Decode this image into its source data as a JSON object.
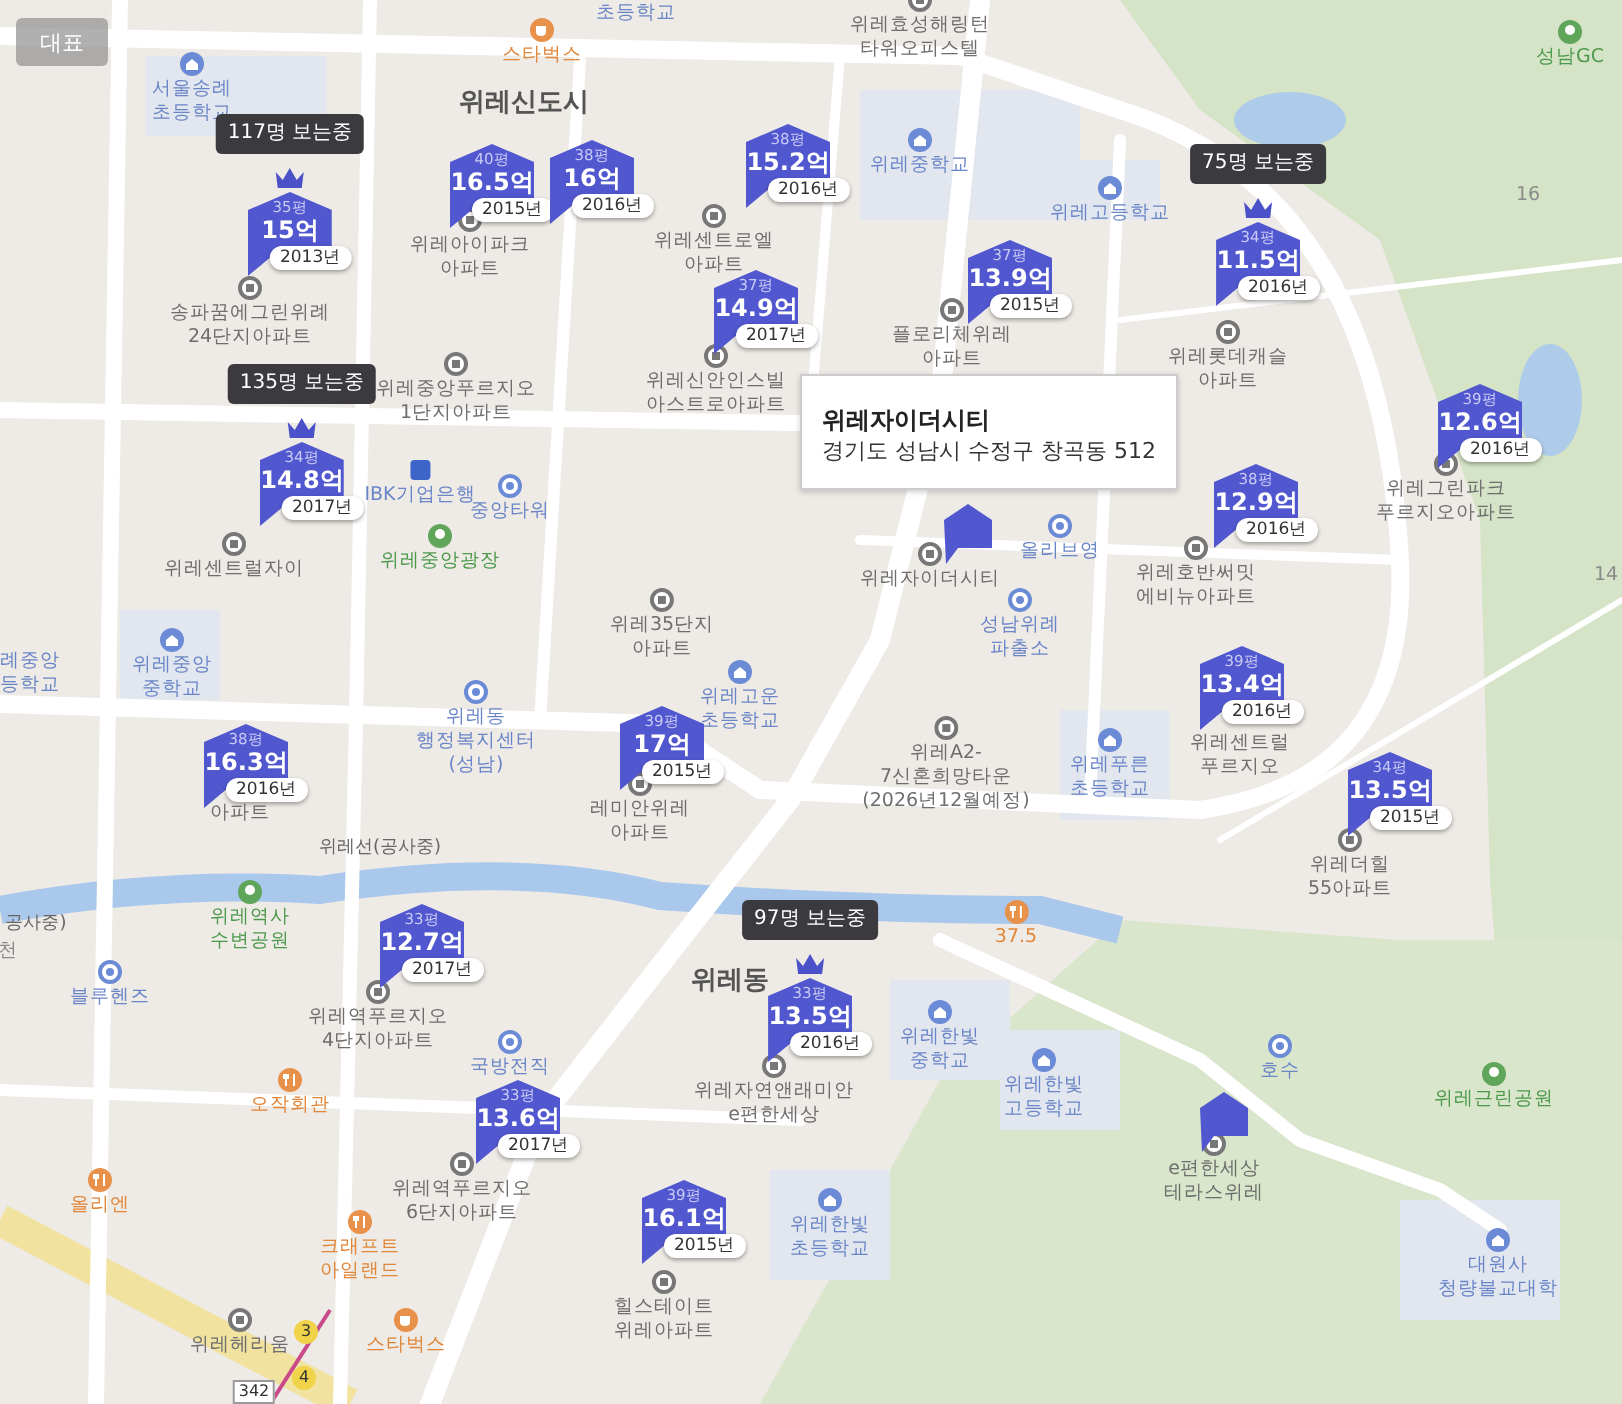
{
  "map_type_button": "대표",
  "markers": [
    {
      "kind": "price",
      "area": "35평",
      "price": "15억",
      "year": "2013년",
      "viewers": "117명 보는중"
    },
    {
      "kind": "price",
      "area": "40평",
      "price": "16.5억",
      "year": "2015년"
    },
    {
      "kind": "price",
      "area": "38평",
      "price": "16억",
      "year": "2016년"
    },
    {
      "kind": "price",
      "area": "38평",
      "price": "15.2억",
      "year": "2016년"
    },
    {
      "kind": "price",
      "area": "37평",
      "price": "14.9억",
      "year": "2017년"
    },
    {
      "kind": "price",
      "area": "37평",
      "price": "13.9억",
      "year": "2015년"
    },
    {
      "kind": "price",
      "area": "34평",
      "price": "11.5억",
      "year": "2016년",
      "viewers": "75명 보는중"
    },
    {
      "kind": "price",
      "area": "34평",
      "price": "14.8억",
      "year": "2017년",
      "viewers": "135명 보는중"
    },
    {
      "kind": "price",
      "area": "39평",
      "price": "12.6억",
      "year": "2016년"
    },
    {
      "kind": "price",
      "area": "38평",
      "price": "12.9억",
      "year": "2016년"
    },
    {
      "kind": "price",
      "area": "39평",
      "price": "13.4억",
      "year": "2016년"
    },
    {
      "kind": "price",
      "area": "38평",
      "price": "16.3억",
      "year": "2016년"
    },
    {
      "kind": "price",
      "area": "39평",
      "price": "17억",
      "year": "2015년"
    },
    {
      "kind": "price",
      "area": "34평",
      "price": "13.5억",
      "year": "2015년"
    },
    {
      "kind": "price",
      "area": "33평",
      "price": "12.7억",
      "year": "2017년"
    },
    {
      "kind": "price",
      "area": "33평",
      "price": "13.5억",
      "year": "2016년",
      "viewers": "97명 보는중"
    },
    {
      "kind": "price",
      "area": "33평",
      "price": "13.6억",
      "year": "2017년"
    },
    {
      "kind": "price",
      "area": "39평",
      "price": "16.1억",
      "year": "2015년"
    },
    {
      "kind": "plain"
    },
    {
      "kind": "plain"
    }
  ],
  "places": [
    {
      "kind": "school",
      "lines": [
        "서울송례",
        "초등학교"
      ]
    },
    {
      "kind": "cafe",
      "lines": [
        "스타벅스"
      ]
    },
    {
      "kind": "school_text",
      "lines": [
        "초등학교"
      ]
    },
    {
      "kind": "apt",
      "lines": [
        "위레효성해링턴",
        "타워오피스텔"
      ]
    },
    {
      "kind": "area",
      "lines": [
        "위레신도시"
      ]
    },
    {
      "kind": "school",
      "lines": [
        "위레중학교"
      ]
    },
    {
      "kind": "school",
      "lines": [
        "위레고등학교"
      ]
    },
    {
      "kind": "park",
      "lines": [
        "성남GC"
      ]
    },
    {
      "kind": "text",
      "lines": [
        "16"
      ]
    },
    {
      "kind": "text",
      "lines": [
        "14"
      ]
    },
    {
      "kind": "apt",
      "lines": [
        "송파꿈에그린위례",
        "24단지아파트"
      ]
    },
    {
      "kind": "apt",
      "lines": [
        "위레아이파크",
        "아파트"
      ]
    },
    {
      "kind": "apt",
      "lines": [
        "위레센트로엘",
        "아파트"
      ]
    },
    {
      "kind": "apt",
      "lines": [
        "플로리체위레",
        "아파트"
      ]
    },
    {
      "kind": "apt",
      "lines": [
        "위레롯데캐슬",
        "아파트"
      ]
    },
    {
      "kind": "apt",
      "lines": [
        "위레중앙푸르지오",
        "1단지아파트"
      ]
    },
    {
      "kind": "apt",
      "lines": [
        "위레신안인스빌",
        "아스트로아파트"
      ]
    },
    {
      "kind": "bank",
      "lines": [
        "IBK기업은행"
      ]
    },
    {
      "kind": "poi",
      "lines": [
        "중앙타워"
      ]
    },
    {
      "kind": "apt",
      "lines": [
        "위레센트럴자이"
      ]
    },
    {
      "kind": "park",
      "lines": [
        "위레중앙광장"
      ]
    },
    {
      "kind": "apt",
      "lines": [
        "위레자이더시티"
      ]
    },
    {
      "kind": "poi",
      "lines": [
        "올리브영"
      ]
    },
    {
      "kind": "apt",
      "lines": [
        "위레35단지",
        "아파트"
      ]
    },
    {
      "kind": "poi",
      "lines": [
        "성남위례",
        "파출소"
      ]
    },
    {
      "kind": "apt",
      "lines": [
        "위레그린파크",
        "푸르지오아파트"
      ]
    },
    {
      "kind": "apt",
      "lines": [
        "위레호반써밋",
        "에비뉴아파트"
      ]
    },
    {
      "kind": "school_text",
      "lines": [
        "례중앙",
        "등학교"
      ]
    },
    {
      "kind": "school",
      "lines": [
        "위레중앙",
        "중학교"
      ]
    },
    {
      "kind": "poi",
      "lines": [
        "위레동",
        "행정복지센터",
        "(성남)"
      ]
    },
    {
      "kind": "school",
      "lines": [
        "위레고운",
        "초등학교"
      ]
    },
    {
      "kind": "apt",
      "lines": [
        "위레A2-",
        "7신혼희망타운",
        "(2026년12월예정)"
      ]
    },
    {
      "kind": "school",
      "lines": [
        "위레푸른",
        "초등학교"
      ]
    },
    {
      "kind": "apt_text",
      "lines": [
        "위레센트럴",
        "푸르지오"
      ]
    },
    {
      "kind": "apt_text",
      "lines": [
        "아파트"
      ]
    },
    {
      "kind": "apt",
      "lines": [
        "레미안위레",
        "아파트"
      ]
    },
    {
      "kind": "apt",
      "lines": [
        "위레더힐",
        "55아파트"
      ]
    },
    {
      "kind": "rail",
      "lines": [
        "위레선(공사중)"
      ]
    },
    {
      "kind": "rail",
      "lines": [
        "공사중)"
      ]
    },
    {
      "kind": "text",
      "lines": [
        "천"
      ]
    },
    {
      "kind": "park",
      "lines": [
        "위레역사",
        "수변공원"
      ]
    },
    {
      "kind": "poi",
      "lines": [
        "블루헨즈"
      ]
    },
    {
      "kind": "apt",
      "lines": [
        "위레역푸르지오",
        "4단지아파트"
      ]
    },
    {
      "kind": "food",
      "lines": [
        "오작회관"
      ]
    },
    {
      "kind": "poi",
      "lines": [
        "국방전직"
      ]
    },
    {
      "kind": "food",
      "lines": [
        "올리엔"
      ]
    },
    {
      "kind": "apt",
      "lines": [
        "위레역푸르지오",
        "6단지아파트"
      ]
    },
    {
      "kind": "food",
      "lines": [
        "크래프트",
        "아일랜드"
      ]
    },
    {
      "kind": "apt",
      "lines": [
        "위레헤리움"
      ]
    },
    {
      "kind": "cafe",
      "lines": [
        "스타벅스"
      ]
    },
    {
      "kind": "area",
      "lines": [
        "위레동"
      ]
    },
    {
      "kind": "food",
      "lines": [
        "37.5"
      ]
    },
    {
      "kind": "apt",
      "lines": [
        "위레자연앤래미안",
        "e편한세상"
      ]
    },
    {
      "kind": "school",
      "lines": [
        "위레한빛",
        "중학교"
      ]
    },
    {
      "kind": "school",
      "lines": [
        "위레한빛",
        "고등학교"
      ]
    },
    {
      "kind": "poi",
      "lines": [
        "호수"
      ]
    },
    {
      "kind": "park",
      "lines": [
        "위레근린공원"
      ]
    },
    {
      "kind": "apt",
      "lines": [
        "e편한세상",
        "테라스위레"
      ]
    },
    {
      "kind": "school",
      "lines": [
        "위레한빛",
        "초등학교"
      ]
    },
    {
      "kind": "apt",
      "lines": [
        "힐스테이트",
        "위레아파트"
      ]
    },
    {
      "kind": "school",
      "lines": [
        "대원사",
        "청량불교대학"
      ]
    },
    {
      "kind": "exit",
      "lines": [
        "3"
      ]
    },
    {
      "kind": "road",
      "lines": [
        "342"
      ]
    },
    {
      "kind": "exit",
      "lines": [
        "4"
      ]
    }
  ],
  "info_popup": {
    "title": "위레자이더시티",
    "address": "경기도 성남시 수정구 창곡동 512"
  }
}
